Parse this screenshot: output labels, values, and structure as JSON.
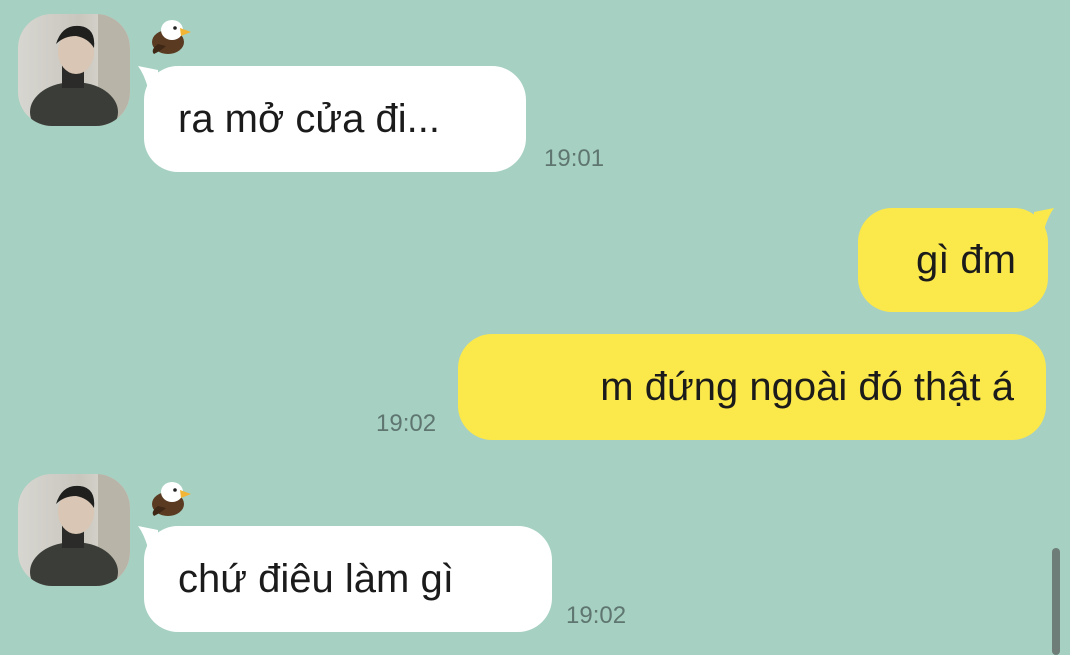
{
  "colors": {
    "background": "#a6d0c2",
    "incoming_bubble": "#ffffff",
    "outgoing_bubble": "#fbe84b",
    "timestamp": "#5f7670"
  },
  "messages": [
    {
      "direction": "incoming",
      "icon": "eagle-icon",
      "text": "ra mở cửa đi...",
      "time": "19:01"
    },
    {
      "direction": "outgoing",
      "text": "gì đm",
      "time": ""
    },
    {
      "direction": "outgoing",
      "text": "m đứng ngoài đó thật á",
      "time": "19:02"
    },
    {
      "direction": "incoming",
      "icon": "eagle-icon",
      "text": "chứ điêu làm gì",
      "time": "19:02"
    }
  ]
}
